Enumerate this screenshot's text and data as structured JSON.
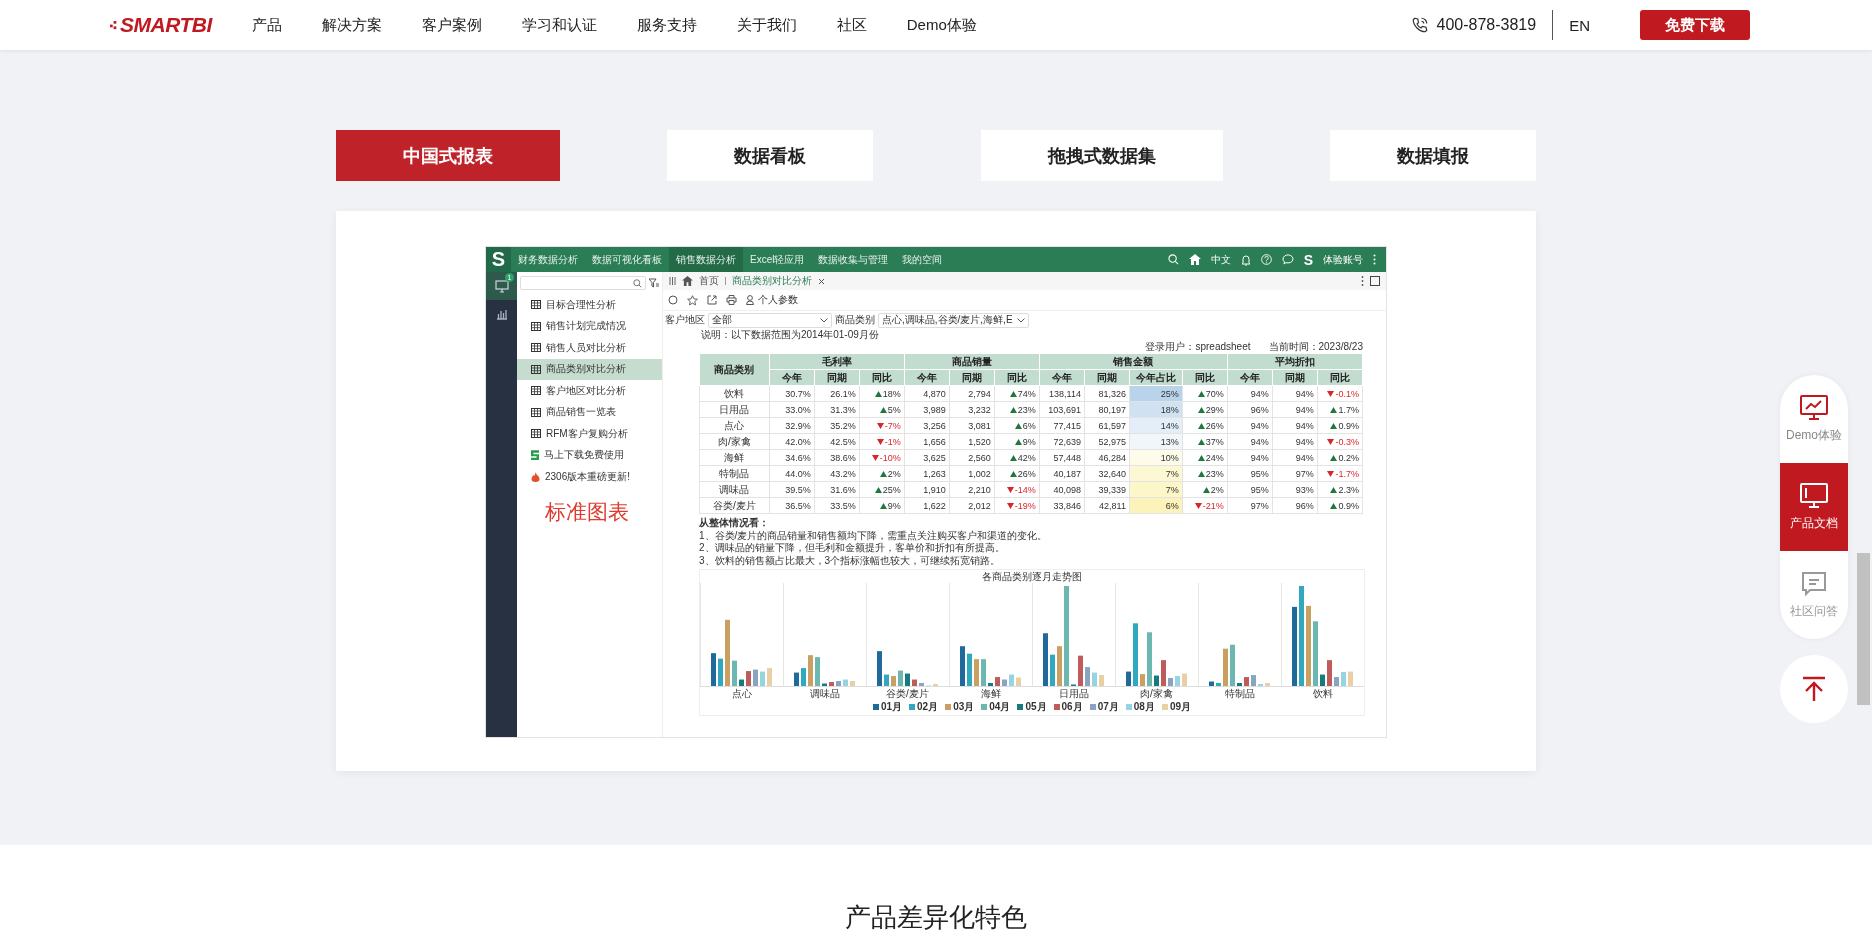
{
  "header": {
    "logo": "SMARTBI",
    "nav": [
      "产品",
      "解决方案",
      "客户案例",
      "学习和认证",
      "服务支持",
      "关于我们",
      "社区",
      "Demo体验"
    ],
    "phone": "400-878-3819",
    "lang": "EN",
    "download": "免费下载"
  },
  "tabs": [
    {
      "label": "中国式报表",
      "selected": true
    },
    {
      "label": "数据看板",
      "selected": false
    },
    {
      "label": "拖拽式数据集",
      "selected": false
    },
    {
      "label": "数据填报",
      "selected": false
    }
  ],
  "app": {
    "logo": "S",
    "menu": [
      {
        "label": "财务数据分析",
        "selected": false
      },
      {
        "label": "数据可视化看板",
        "selected": false
      },
      {
        "label": "销售数据分析",
        "selected": true
      },
      {
        "label": "Excel轻应用",
        "selected": false
      },
      {
        "label": "数据收集与管理",
        "selected": false
      },
      {
        "label": "我的空间",
        "selected": false
      }
    ],
    "lang": "中文",
    "account_logo": "S",
    "account": "体验账号",
    "rail": [
      {
        "kind": "monitor",
        "selected": true,
        "badge": "1"
      },
      {
        "kind": "chart",
        "selected": false
      }
    ],
    "tree": [
      {
        "label": "目标合理性分析",
        "kind": "report",
        "selected": false
      },
      {
        "label": "销售计划完成情况",
        "kind": "report",
        "selected": false
      },
      {
        "label": "销售人员对比分析",
        "kind": "report",
        "selected": false
      },
      {
        "label": "商品类别对比分析",
        "kind": "report",
        "selected": true
      },
      {
        "label": "客户地区对比分析",
        "kind": "report",
        "selected": false
      },
      {
        "label": "商品销售一览表",
        "kind": "report",
        "selected": false
      },
      {
        "label": "RFM客户复购分析",
        "kind": "report",
        "selected": false
      },
      {
        "label": "马上下载免费使用",
        "kind": "promo",
        "selected": false
      },
      {
        "label": "2306版本重磅更新!",
        "kind": "news",
        "selected": false
      }
    ],
    "overlay_label": "标准图表",
    "breadcrumb": {
      "home": "首页",
      "tab": "商品类别对比分析"
    },
    "toolbar": {
      "params": "个人参数"
    },
    "filters": [
      {
        "label": "客户地区",
        "value": "全部"
      },
      {
        "label": "商品类别",
        "value": "点心,调味品,谷类/麦片,海鲜,E"
      }
    ],
    "note": "说明：以下数据范围为2014年01-09月份",
    "login": "登录用户：spreadsheet",
    "time": "当前时间：2023/8/23",
    "table": {
      "corner": "商品类别",
      "groups": [
        {
          "label": "毛利率",
          "columns": [
            "今年",
            "同期",
            "同比"
          ]
        },
        {
          "label": "商品销量",
          "columns": [
            "今年",
            "同期",
            "同比"
          ]
        },
        {
          "label": "销售金额",
          "columns": [
            "今年",
            "同期",
            "今年占比",
            "同比"
          ]
        },
        {
          "label": "平均折扣",
          "columns": [
            "今年",
            "同期",
            "同比"
          ]
        }
      ],
      "rows": [
        {
          "name": "饮料",
          "cells": [
            {
              "text": "30.7%"
            },
            {
              "text": "26.1%"
            },
            {
              "text": "18%",
              "rising": true
            },
            {
              "text": "4,870"
            },
            {
              "text": "2,794"
            },
            {
              "text": "74%",
              "rising": true
            },
            {
              "text": "138,114"
            },
            {
              "text": "81,326"
            },
            {
              "text": "25%",
              "color": "#b9d3ea"
            },
            {
              "text": "70%",
              "rising": true
            },
            {
              "text": "94%"
            },
            {
              "text": "94%"
            },
            {
              "text": "-0.1%",
              "rising": false
            }
          ]
        },
        {
          "name": "日用品",
          "cells": [
            {
              "text": "33.0%"
            },
            {
              "text": "31.3%"
            },
            {
              "text": "5%",
              "rising": true
            },
            {
              "text": "3,989"
            },
            {
              "text": "3,232"
            },
            {
              "text": "23%",
              "rising": true
            },
            {
              "text": "103,691"
            },
            {
              "text": "80,197"
            },
            {
              "text": "18%",
              "color": "#d0e2f2"
            },
            {
              "text": "29%",
              "rising": true
            },
            {
              "text": "96%"
            },
            {
              "text": "94%"
            },
            {
              "text": "1.7%",
              "rising": true
            }
          ]
        },
        {
          "name": "点心",
          "cells": [
            {
              "text": "32.9%"
            },
            {
              "text": "35.2%"
            },
            {
              "text": "-7%",
              "rising": false
            },
            {
              "text": "3,256"
            },
            {
              "text": "3,081"
            },
            {
              "text": "6%",
              "rising": true
            },
            {
              "text": "77,415"
            },
            {
              "text": "61,597"
            },
            {
              "text": "14%",
              "color": "#e3eef8"
            },
            {
              "text": "26%",
              "rising": true
            },
            {
              "text": "94%"
            },
            {
              "text": "94%"
            },
            {
              "text": "0.9%",
              "rising": true
            }
          ]
        },
        {
          "name": "肉/家禽",
          "cells": [
            {
              "text": "42.0%"
            },
            {
              "text": "42.5%"
            },
            {
              "text": "-1%",
              "rising": false
            },
            {
              "text": "1,656"
            },
            {
              "text": "1,520"
            },
            {
              "text": "9%",
              "rising": true
            },
            {
              "text": "72,639"
            },
            {
              "text": "52,975"
            },
            {
              "text": "13%",
              "color": "#f1f6fb"
            },
            {
              "text": "37%",
              "rising": true
            },
            {
              "text": "94%"
            },
            {
              "text": "94%"
            },
            {
              "text": "-0.3%",
              "rising": false
            }
          ]
        },
        {
          "name": "海鲜",
          "cells": [
            {
              "text": "34.6%"
            },
            {
              "text": "38.6%"
            },
            {
              "text": "-10%",
              "rising": false
            },
            {
              "text": "3,625"
            },
            {
              "text": "2,560"
            },
            {
              "text": "42%",
              "rising": true
            },
            {
              "text": "57,448"
            },
            {
              "text": "46,284"
            },
            {
              "text": "10%",
              "color": "#fdfbea"
            },
            {
              "text": "24%",
              "rising": true
            },
            {
              "text": "94%"
            },
            {
              "text": "94%"
            },
            {
              "text": "0.2%",
              "rising": true
            }
          ]
        },
        {
          "name": "特制品",
          "cells": [
            {
              "text": "44.0%"
            },
            {
              "text": "43.2%"
            },
            {
              "text": "2%",
              "rising": true
            },
            {
              "text": "1,263"
            },
            {
              "text": "1,002"
            },
            {
              "text": "26%",
              "rising": true
            },
            {
              "text": "40,187"
            },
            {
              "text": "32,640"
            },
            {
              "text": "7%",
              "color": "#fdf8d4"
            },
            {
              "text": "23%",
              "rising": true
            },
            {
              "text": "95%"
            },
            {
              "text": "97%"
            },
            {
              "text": "-1.7%",
              "rising": false
            }
          ]
        },
        {
          "name": "调味品",
          "cells": [
            {
              "text": "39.5%"
            },
            {
              "text": "31.6%"
            },
            {
              "text": "25%",
              "rising": true
            },
            {
              "text": "1,910"
            },
            {
              "text": "2,210"
            },
            {
              "text": "-14%",
              "rising": false
            },
            {
              "text": "40,098"
            },
            {
              "text": "39,339"
            },
            {
              "text": "7%",
              "color": "#fdf6c9"
            },
            {
              "text": "2%",
              "rising": true
            },
            {
              "text": "95%"
            },
            {
              "text": "93%"
            },
            {
              "text": "2.3%",
              "rising": true
            }
          ]
        },
        {
          "name": "谷类/麦片",
          "cells": [
            {
              "text": "36.5%"
            },
            {
              "text": "33.5%"
            },
            {
              "text": "9%",
              "rising": true
            },
            {
              "text": "1,622"
            },
            {
              "text": "2,012"
            },
            {
              "text": "-19%",
              "rising": false
            },
            {
              "text": "33,846"
            },
            {
              "text": "42,811"
            },
            {
              "text": "6%",
              "color": "#fcf3bb"
            },
            {
              "text": "-21%",
              "rising": false
            },
            {
              "text": "97%"
            },
            {
              "text": "96%"
            },
            {
              "text": "0.9%",
              "rising": true
            }
          ]
        }
      ]
    },
    "summary": {
      "title": "从整体情况看：",
      "lines": [
        "1、谷类/麦片的商品销量和销售额均下降，需重点关注购买客户和渠道的变化。",
        "2、调味品的销量下降，但毛利和金额提升，客单价和折扣有所提高。",
        "3、饮料的销售额占比最大，3个指标涨幅也较大，可继续拓宽销路。"
      ]
    },
    "chart": {
      "title": "各商品类别逐月走势图",
      "categories": [
        "点心",
        "调味品",
        "谷类/麦片",
        "海鲜",
        "日用品",
        "肉/家禽",
        "特制品",
        "饮料"
      ],
      "legend": [
        {
          "label": "01月",
          "color": "#1f6a9a"
        },
        {
          "label": "02月",
          "color": "#2fa8c0"
        },
        {
          "label": "03月",
          "color": "#c9a061"
        },
        {
          "label": "04月",
          "color": "#6cb7b0"
        },
        {
          "label": "05月",
          "color": "#177a80"
        },
        {
          "label": "06月",
          "color": "#bf5b5b"
        },
        {
          "label": "07月",
          "color": "#8aa4c0"
        },
        {
          "label": "08月",
          "color": "#96d3e3"
        },
        {
          "label": "09月",
          "color": "#e8cfa4"
        }
      ]
    }
  },
  "side_tools": {
    "items": [
      {
        "label": "Demo体验",
        "kind": "demo",
        "selected": false
      },
      {
        "label": "产品文档",
        "kind": "docs",
        "selected": true
      },
      {
        "label": "社区问答",
        "kind": "qa",
        "selected": false
      }
    ]
  },
  "section_title": "产品差异化特色"
}
